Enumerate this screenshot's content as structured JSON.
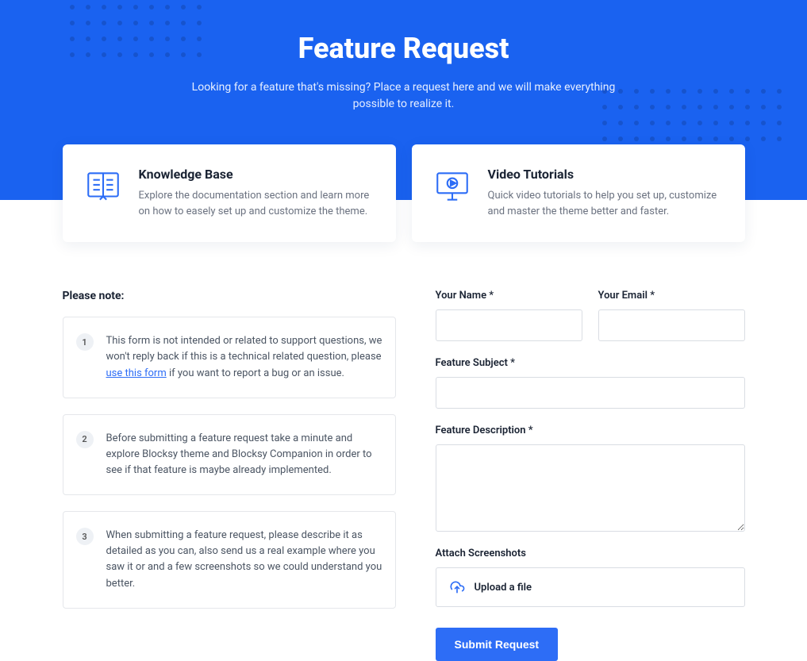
{
  "hero": {
    "title": "Feature Request",
    "subtitle": "Looking for a feature that's missing? Place a request here and we will make everything possible to realize it."
  },
  "cards": {
    "kb": {
      "title": "Knowledge Base",
      "desc": "Explore the documentation section and learn more on how to easely set up and customize the theme."
    },
    "video": {
      "title": "Video Tutorials",
      "desc": "Quick video tutorials to help you set up, customize and master the theme better and faster."
    }
  },
  "notes": {
    "heading": "Please note:",
    "items": [
      {
        "num": "1",
        "pre": "This form is not intended or related to support questions, we won't reply back if this is a technical related question, please ",
        "link": "use this form",
        "post": " if you want to report a bug or an issue."
      },
      {
        "num": "2",
        "text": "Before submitting a feature request take a minute and explore Blocksy theme and Blocksy Companion in order to see if that feature is maybe already implemented."
      },
      {
        "num": "3",
        "text": "When submitting a feature request, please describe it as detailed as you can, also send us a real example where you saw it or and a few screenshots so we could understand you better."
      }
    ]
  },
  "form": {
    "name_label": "Your Name",
    "email_label": "Your Email",
    "subject_label": "Feature Subject",
    "description_label": "Feature Description",
    "attach_label": "Attach Screenshots",
    "upload_label": "Upload a file",
    "submit_label": "Submit Request"
  }
}
